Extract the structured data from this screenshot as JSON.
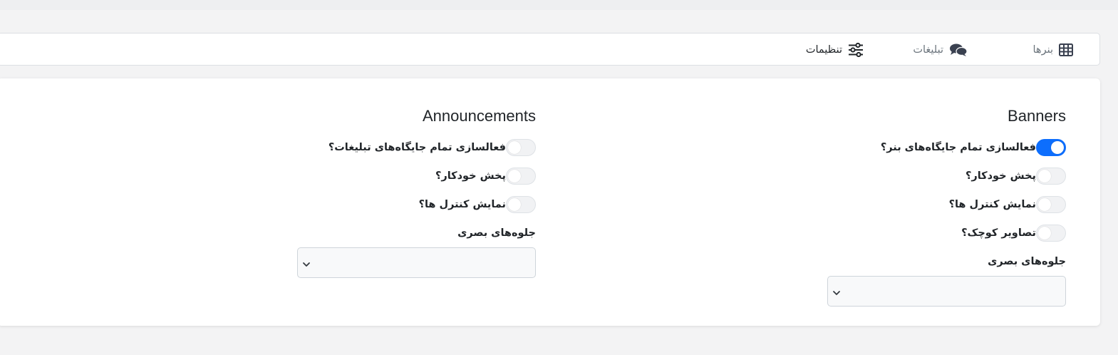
{
  "tabs": {
    "banners": "بنرها",
    "ads": "تبلیغات",
    "settings": "تنظیمات"
  },
  "banners": {
    "title": "Banners",
    "switches": [
      {
        "label": "فعالسازی تمام جایگاه‌های بنر؟",
        "on": true
      },
      {
        "label": "پخش خودکار؟",
        "on": false
      },
      {
        "label": "نمایش کنترل ها؟",
        "on": false
      },
      {
        "label": "تصاویر کوچک؟",
        "on": false
      }
    ],
    "effects_label": "جلوه‌های بصری",
    "effects_value": ""
  },
  "announcements": {
    "title": "Announcements",
    "switches": [
      {
        "label": "فعالسازی تمام جایگاه‌های تبلیغات؟",
        "on": false
      },
      {
        "label": "پخش خودکار؟",
        "on": false
      },
      {
        "label": "نمایش کنترل ها؟",
        "on": false
      }
    ],
    "effects_label": "جلوه‌های بصری",
    "effects_value": ""
  },
  "colors": {
    "accent": "#0d6efd",
    "icon": "#3a4150"
  },
  "icons": {
    "banners": "table-grid-icon",
    "ads": "comments-icon",
    "settings": "sliders-icon",
    "select": "chevron-down-icon"
  }
}
